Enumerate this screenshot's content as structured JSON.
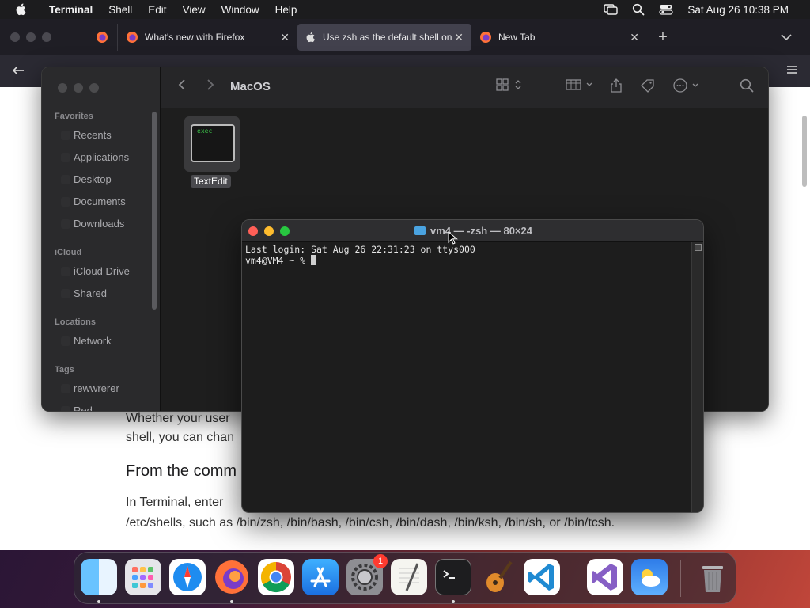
{
  "menubar": {
    "app_name": "Terminal",
    "items": [
      "Shell",
      "Edit",
      "View",
      "Window",
      "Help"
    ],
    "clock": "Sat Aug 26  10:38 PM"
  },
  "firefox": {
    "tabs": [
      {
        "title": "What's new with Firefox",
        "close": "✕"
      },
      {
        "title": "Use zsh as the default shell on y",
        "close": "✕"
      },
      {
        "title": "New Tab",
        "close": "✕"
      }
    ],
    "new_tab_symbol": "+",
    "article": {
      "line1_partial": "Whether your user",
      "line2_partial": "shell, you can chan",
      "heading_partial": "From the comm",
      "para1_partial": "In Terminal, enter",
      "para2": "/etc/shells, such as /bin/zsh, /bin/bash, /bin/csh, /bin/dash, /bin/ksh, /bin/sh, or /bin/tcsh."
    }
  },
  "finder": {
    "title": "MacOS",
    "favorites_label": "Favorites",
    "favorites": [
      "Recents",
      "Applications",
      "Desktop",
      "Documents",
      "Downloads"
    ],
    "icloud_label": "iCloud",
    "icloud": [
      "iCloud Drive",
      "Shared"
    ],
    "locations_label": "Locations",
    "locations": [
      "Network"
    ],
    "tags_label": "Tags",
    "tags": [
      "rewwrerer",
      "Red"
    ],
    "file": {
      "icon_text": "exec",
      "name": "TextEdit"
    }
  },
  "terminal": {
    "title": "vm4 — -zsh — 80×24",
    "line1": "Last login: Sat Aug 26 22:31:23 on ttys000",
    "prompt": "vm4@VM4 ~ % "
  },
  "dock": {
    "apps": [
      "finder-icon",
      "launchpad-icon",
      "safari-icon",
      "firefox-icon",
      "chrome-icon",
      "app-store-icon",
      "system-settings-icon",
      "textedit-icon",
      "terminal-icon",
      "garageband-icon",
      "vscode-icon",
      "visual-studio-icon",
      "weather-icon",
      "trash-icon"
    ],
    "settings_badge": "1"
  },
  "colors": {
    "firefox_orange": "#ff7139",
    "terminal_bg": "#1d1d1d",
    "close_red": "#ff5f57"
  }
}
